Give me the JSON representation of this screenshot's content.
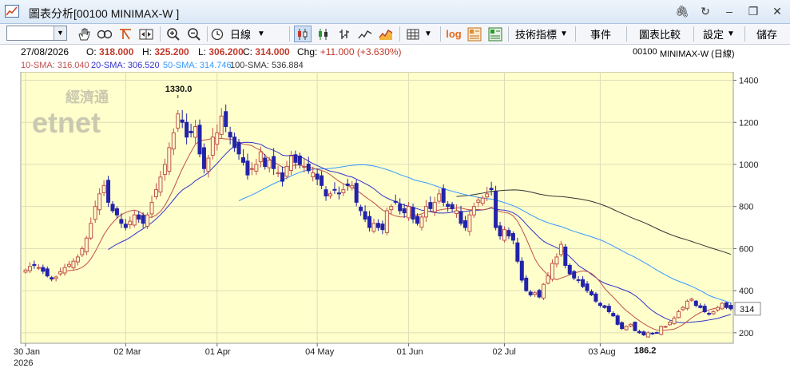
{
  "window": {
    "title": "圖表分析[00100 MINIMAX-W ]"
  },
  "toolbar": {
    "period_label": "日線",
    "indicators_label": "技術指標",
    "events_label": "事件",
    "compare_label": "圖表比較",
    "settings_label": "設定",
    "save_label": "儲存",
    "log_label": "log"
  },
  "quote": {
    "date": "27/08/2026",
    "open_label": "O:",
    "open": "318.000",
    "high_label": "H:",
    "high": "325.200",
    "low_label": "L:",
    "low": "306.200",
    "close_label": "C:",
    "close": "314.000",
    "chg_label": "Chg:",
    "chg": "+11.000 (+3.630%)",
    "symbol": "00100",
    "name": "MINIMAX-W (日線)"
  },
  "sma": [
    {
      "label": "10-SMA:",
      "value": "316.040",
      "color": "#c0504d"
    },
    {
      "label": "20-SMA:",
      "value": "306.520",
      "color": "#3333cc"
    },
    {
      "label": "50-SMA:",
      "value": "314.746",
      "color": "#3399ff"
    },
    {
      "label": "100-SMA:",
      "value": "536.884",
      "color": "#333333"
    }
  ],
  "watermark": {
    "cn": "經濟通",
    "en": "etnet"
  },
  "chart_data": {
    "type": "candlestick",
    "ylim": [
      150,
      1440
    ],
    "y_ticks": [
      200,
      400,
      600,
      800,
      1000,
      1200,
      1400
    ],
    "x_ticks": [
      "30 Jan",
      "02 Mar",
      "01 Apr",
      "04 May",
      "01 Jun",
      "02 Jul",
      "03 Aug"
    ],
    "x_year": "2026",
    "annotations": [
      {
        "label": "1330.0",
        "value": 1330
      },
      {
        "label": "186.2",
        "value": 186.2
      }
    ],
    "last_price_label": "314",
    "up_color": "#c0504d",
    "down_color": "#2222aa",
    "closes": [
      498,
      515,
      520,
      510,
      492,
      470,
      455,
      465,
      490,
      510,
      525,
      540,
      560,
      600,
      650,
      720,
      800,
      860,
      900,
      820,
      780,
      760,
      720,
      700,
      730,
      760,
      740,
      720,
      760,
      820,
      880,
      940,
      1000,
      1080,
      1150,
      1240,
      1200,
      1130,
      1150,
      1180,
      1050,
      980,
      1030,
      1130,
      1150,
      1230,
      1180,
      1130,
      1080,
      1050,
      1010,
      950,
      980,
      1000,
      1060,
      990,
      1020,
      980,
      960,
      920,
      990,
      1040,
      1010,
      1000,
      990,
      970,
      960,
      930,
      900,
      850,
      860,
      880,
      860,
      880,
      900,
      900,
      820,
      780,
      740,
      700,
      720,
      700,
      690,
      780,
      800,
      820,
      780,
      770,
      800,
      740,
      720,
      750,
      800,
      790,
      820,
      860,
      820,
      800,
      790,
      780,
      720,
      700,
      760,
      800,
      830,
      840,
      860,
      880,
      700,
      660,
      690,
      660,
      640,
      540,
      450,
      400,
      380,
      390,
      370,
      430,
      470,
      530,
      560,
      620,
      520,
      480,
      460,
      450,
      420,
      400,
      380,
      350,
      330,
      320,
      300,
      280,
      240,
      220,
      230,
      240,
      210,
      200,
      190,
      200,
      195,
      200,
      230,
      230,
      250,
      270,
      300,
      320,
      350,
      360,
      330,
      320,
      300,
      290,
      300,
      320,
      340,
      320,
      314
    ]
  }
}
